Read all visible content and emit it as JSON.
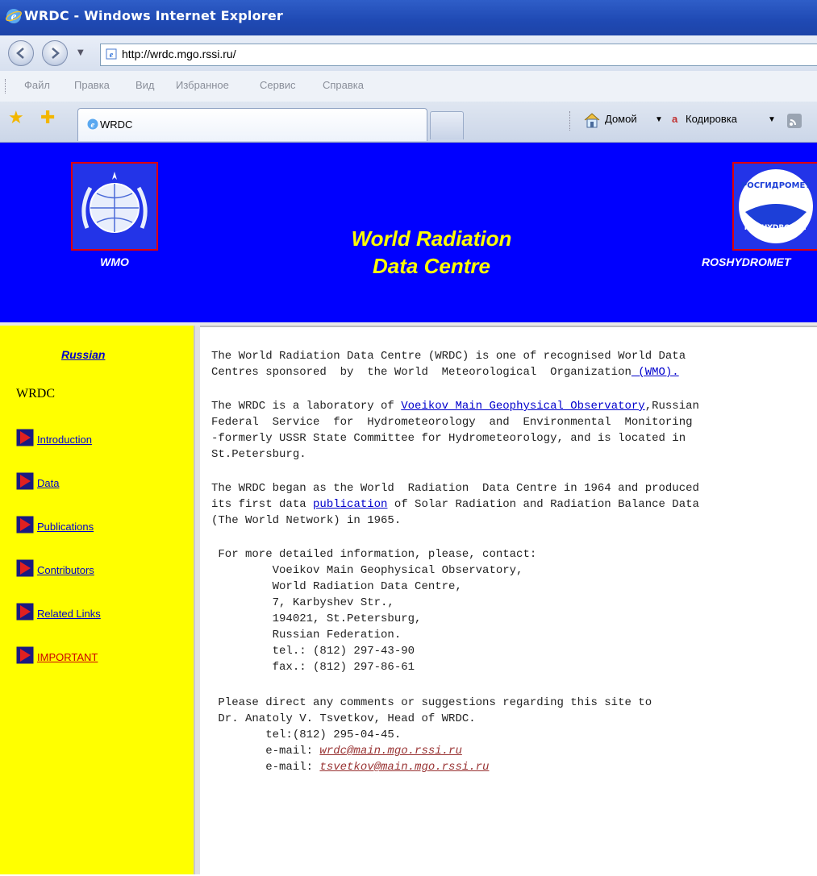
{
  "window": {
    "title": "WRDC - Windows Internet Explorer"
  },
  "address": {
    "url": "http://wrdc.mgo.rssi.ru/"
  },
  "menu": [
    "Файл",
    "Правка",
    "Вид",
    "Избранное",
    "Сервис",
    "Справка"
  ],
  "tab": {
    "label": "WRDC"
  },
  "commands": {
    "home": "Домой",
    "encoding": "Кодировка"
  },
  "header": {
    "left_logo_label": "WMO",
    "title_line1": "World Radiation",
    "title_line2": "Data Centre",
    "right_logo_label": "ROSHYDROMET",
    "right_logo_text_top": "РОСГИДРОМЕТ",
    "right_logo_text_bottom": "ROSHYDROMET"
  },
  "sidebar": {
    "language_link": "Russian",
    "section": "WRDC",
    "items": [
      "Introduction",
      "Data",
      "Publications",
      "Contributors",
      "Related Links",
      "IMPORTANT"
    ]
  },
  "content": {
    "p1_l1": "The World Radiation Data Centre (WRDC) is one of recognised World Data",
    "p1_l2": "Centres sponsored  by  the World  Meteorological  Organization",
    "p1_link": " (WMO).",
    "p2_l1_pre": "The WRDC is a laboratory of ",
    "p2_link": "Voeikov Main Geophysical Observatory",
    "p2_l1_post": ",Russian",
    "p2_l2": "Federal  Service  for  Hydrometeorology  and  Environmental  Monitoring",
    "p2_l3": "-formerly USSR State Committee for Hydrometeorology, and is located in",
    "p2_l4": "St.Petersburg.",
    "p3_l1": "The WRDC began as the World  Radiation  Data Centre in 1964 and produced",
    "p3_l2_pre": "its first data ",
    "p3_link": "publication",
    "p3_l2_post": " of Solar Radiation and Radiation Balance Data",
    "p3_l3": "(The World Network) in 1965.",
    "contact_intro": " For more detailed information, please, contact:",
    "contact_lines": [
      "         Voeikov Main Geophysical Observatory,",
      "         World Radiation Data Centre,",
      "         7, Karbyshev Str.,",
      "         194021, St.Petersburg,",
      "         Russian Federation.",
      "         tel.: (812) 297-43-90",
      "         fax.: (812) 297-86-61"
    ],
    "comments_l1": " Please direct any comments or suggestions regarding this site to",
    "comments_l2": " Dr. Anatoly V. Tsvetkov, Head of WRDC.",
    "tel2": "        tel:(812) 295-04-45.",
    "email_label": "        e-mail: ",
    "email1": "wrdc@main.mgo.rssi.ru",
    "email2": "tsvetkov@main.mgo.rssi.ru"
  },
  "colors": {
    "header_bg": "#0000ff",
    "sidebar_bg": "#ffff00",
    "title": "#ffff00"
  }
}
